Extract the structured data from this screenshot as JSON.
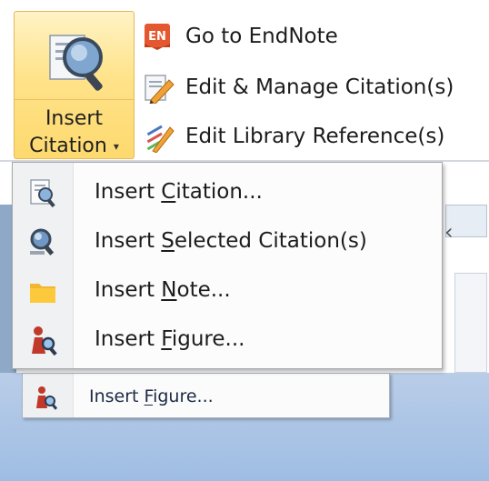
{
  "ribbon": {
    "insert_citation": {
      "line1": "Insert",
      "line2": "Citation",
      "caret": "▾"
    },
    "side_buttons": [
      {
        "label": "Go to EndNote",
        "icon": "endnote-icon",
        "badge": "EN"
      },
      {
        "label": "Edit & Manage Citation(s)",
        "icon": "edit-citation-icon"
      },
      {
        "label": "Edit Library Reference(s)",
        "icon": "edit-reference-icon"
      }
    ]
  },
  "dropdown": {
    "items": [
      {
        "before": "Insert ",
        "mnemonic": "C",
        "after": "itation...",
        "icon": "insert-citation-icon"
      },
      {
        "before": "Insert ",
        "mnemonic": "S",
        "after": "elected Citation(s)",
        "icon": "insert-selected-citation-icon"
      },
      {
        "before": "Insert ",
        "mnemonic": "N",
        "after": "ote...",
        "icon": "folder-icon"
      },
      {
        "before": "Insert ",
        "mnemonic": "F",
        "after": "igure...",
        "icon": "insert-figure-icon"
      }
    ]
  },
  "ghost_item": {
    "before": "Insert ",
    "mnemonic": "F",
    "after": "igure...",
    "icon": "insert-figure-icon"
  },
  "colors": {
    "highlight": "#ffe38a",
    "accent_blue": "#2b6cb0",
    "icon_red": "#c0392b",
    "bg_blue": "#a9c3e6"
  }
}
